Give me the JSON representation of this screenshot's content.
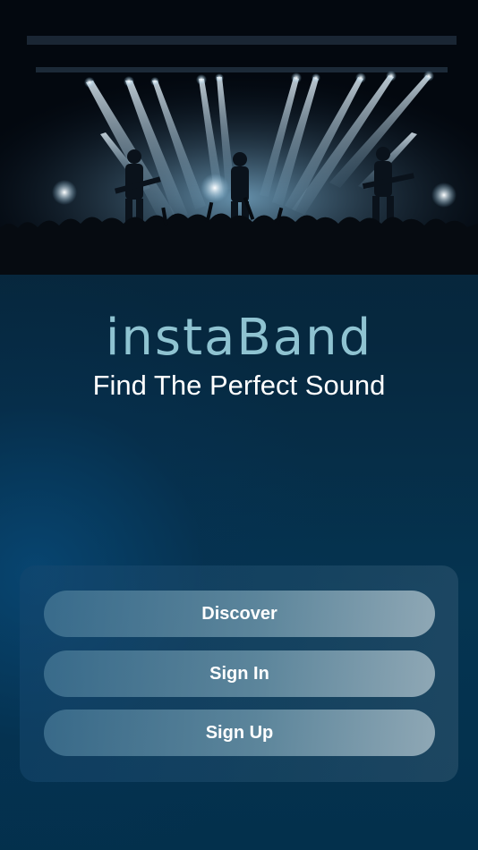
{
  "app": {
    "logo_text": "instaBand",
    "tagline": "Find The Perfect Sound"
  },
  "hero": {
    "image": "concert-stage-photo"
  },
  "actions": {
    "discover_label": "Discover",
    "sign_in_label": "Sign In",
    "sign_up_label": "Sign Up"
  },
  "colors": {
    "logo": "#8fc3d1",
    "background": "#05243a",
    "text": "#ffffff"
  }
}
